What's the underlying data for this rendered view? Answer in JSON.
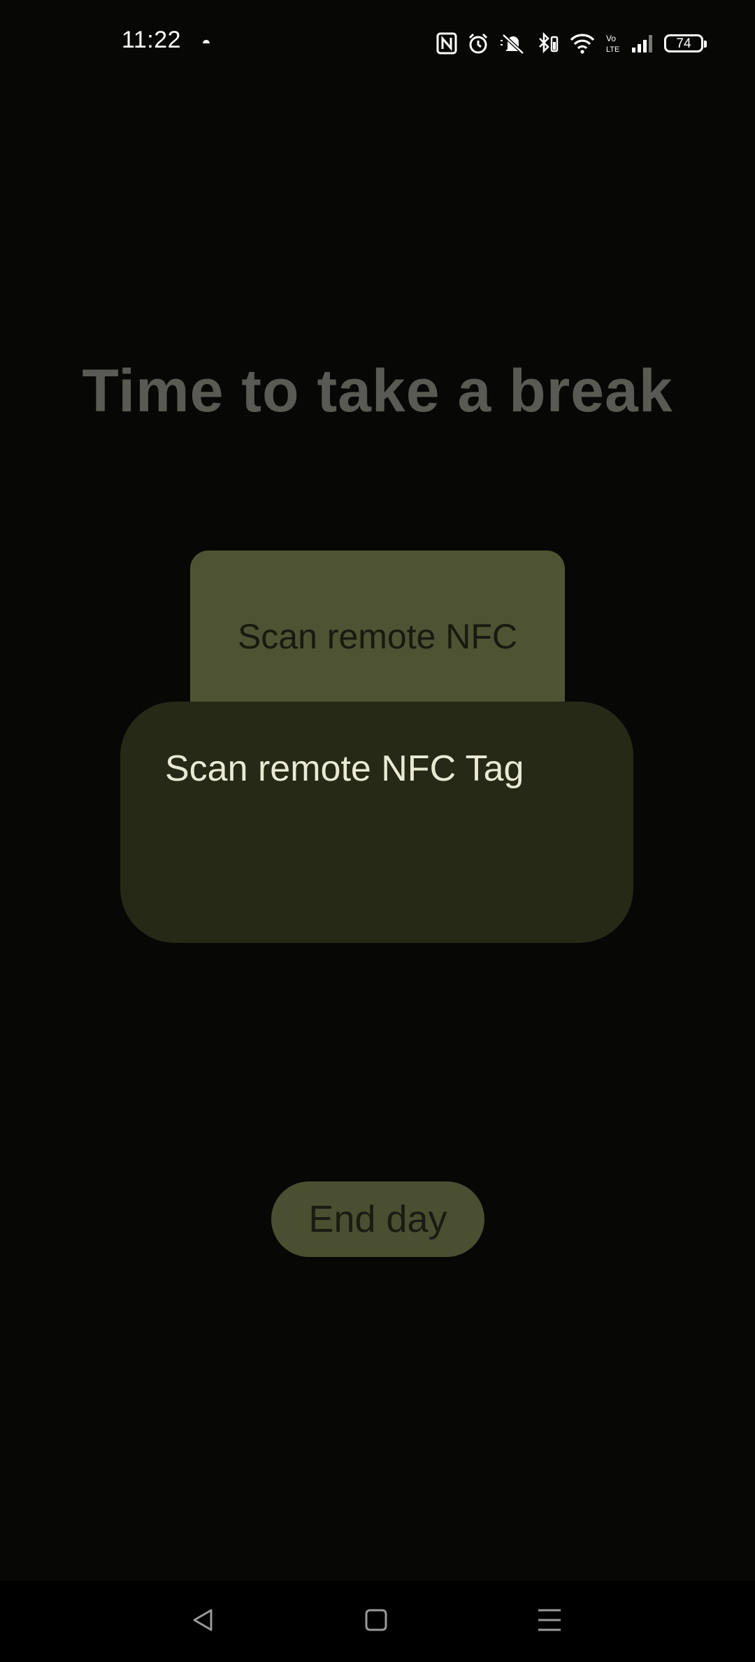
{
  "status_bar": {
    "time": "11:22",
    "battery_level": "74",
    "icons": [
      "weather-icon",
      "nfc-icon",
      "alarm-icon",
      "silent-icon",
      "bluetooth-icon",
      "wifi-icon",
      "volte-icon",
      "signal-icon",
      "battery-icon"
    ]
  },
  "main": {
    "title": "Time to take a break",
    "scan_button_label": "Scan remote NFC",
    "popup_text": "Scan remote NFC Tag",
    "end_day_label": "End day"
  },
  "nav_bar": {
    "icons": [
      "back-icon",
      "home-icon",
      "menu-icon"
    ]
  },
  "colors": {
    "background": "#070805",
    "title": "#5a5a55",
    "scan_button": "#4e5333",
    "popup": "#262916",
    "end_day_button": "#4b4f31"
  }
}
